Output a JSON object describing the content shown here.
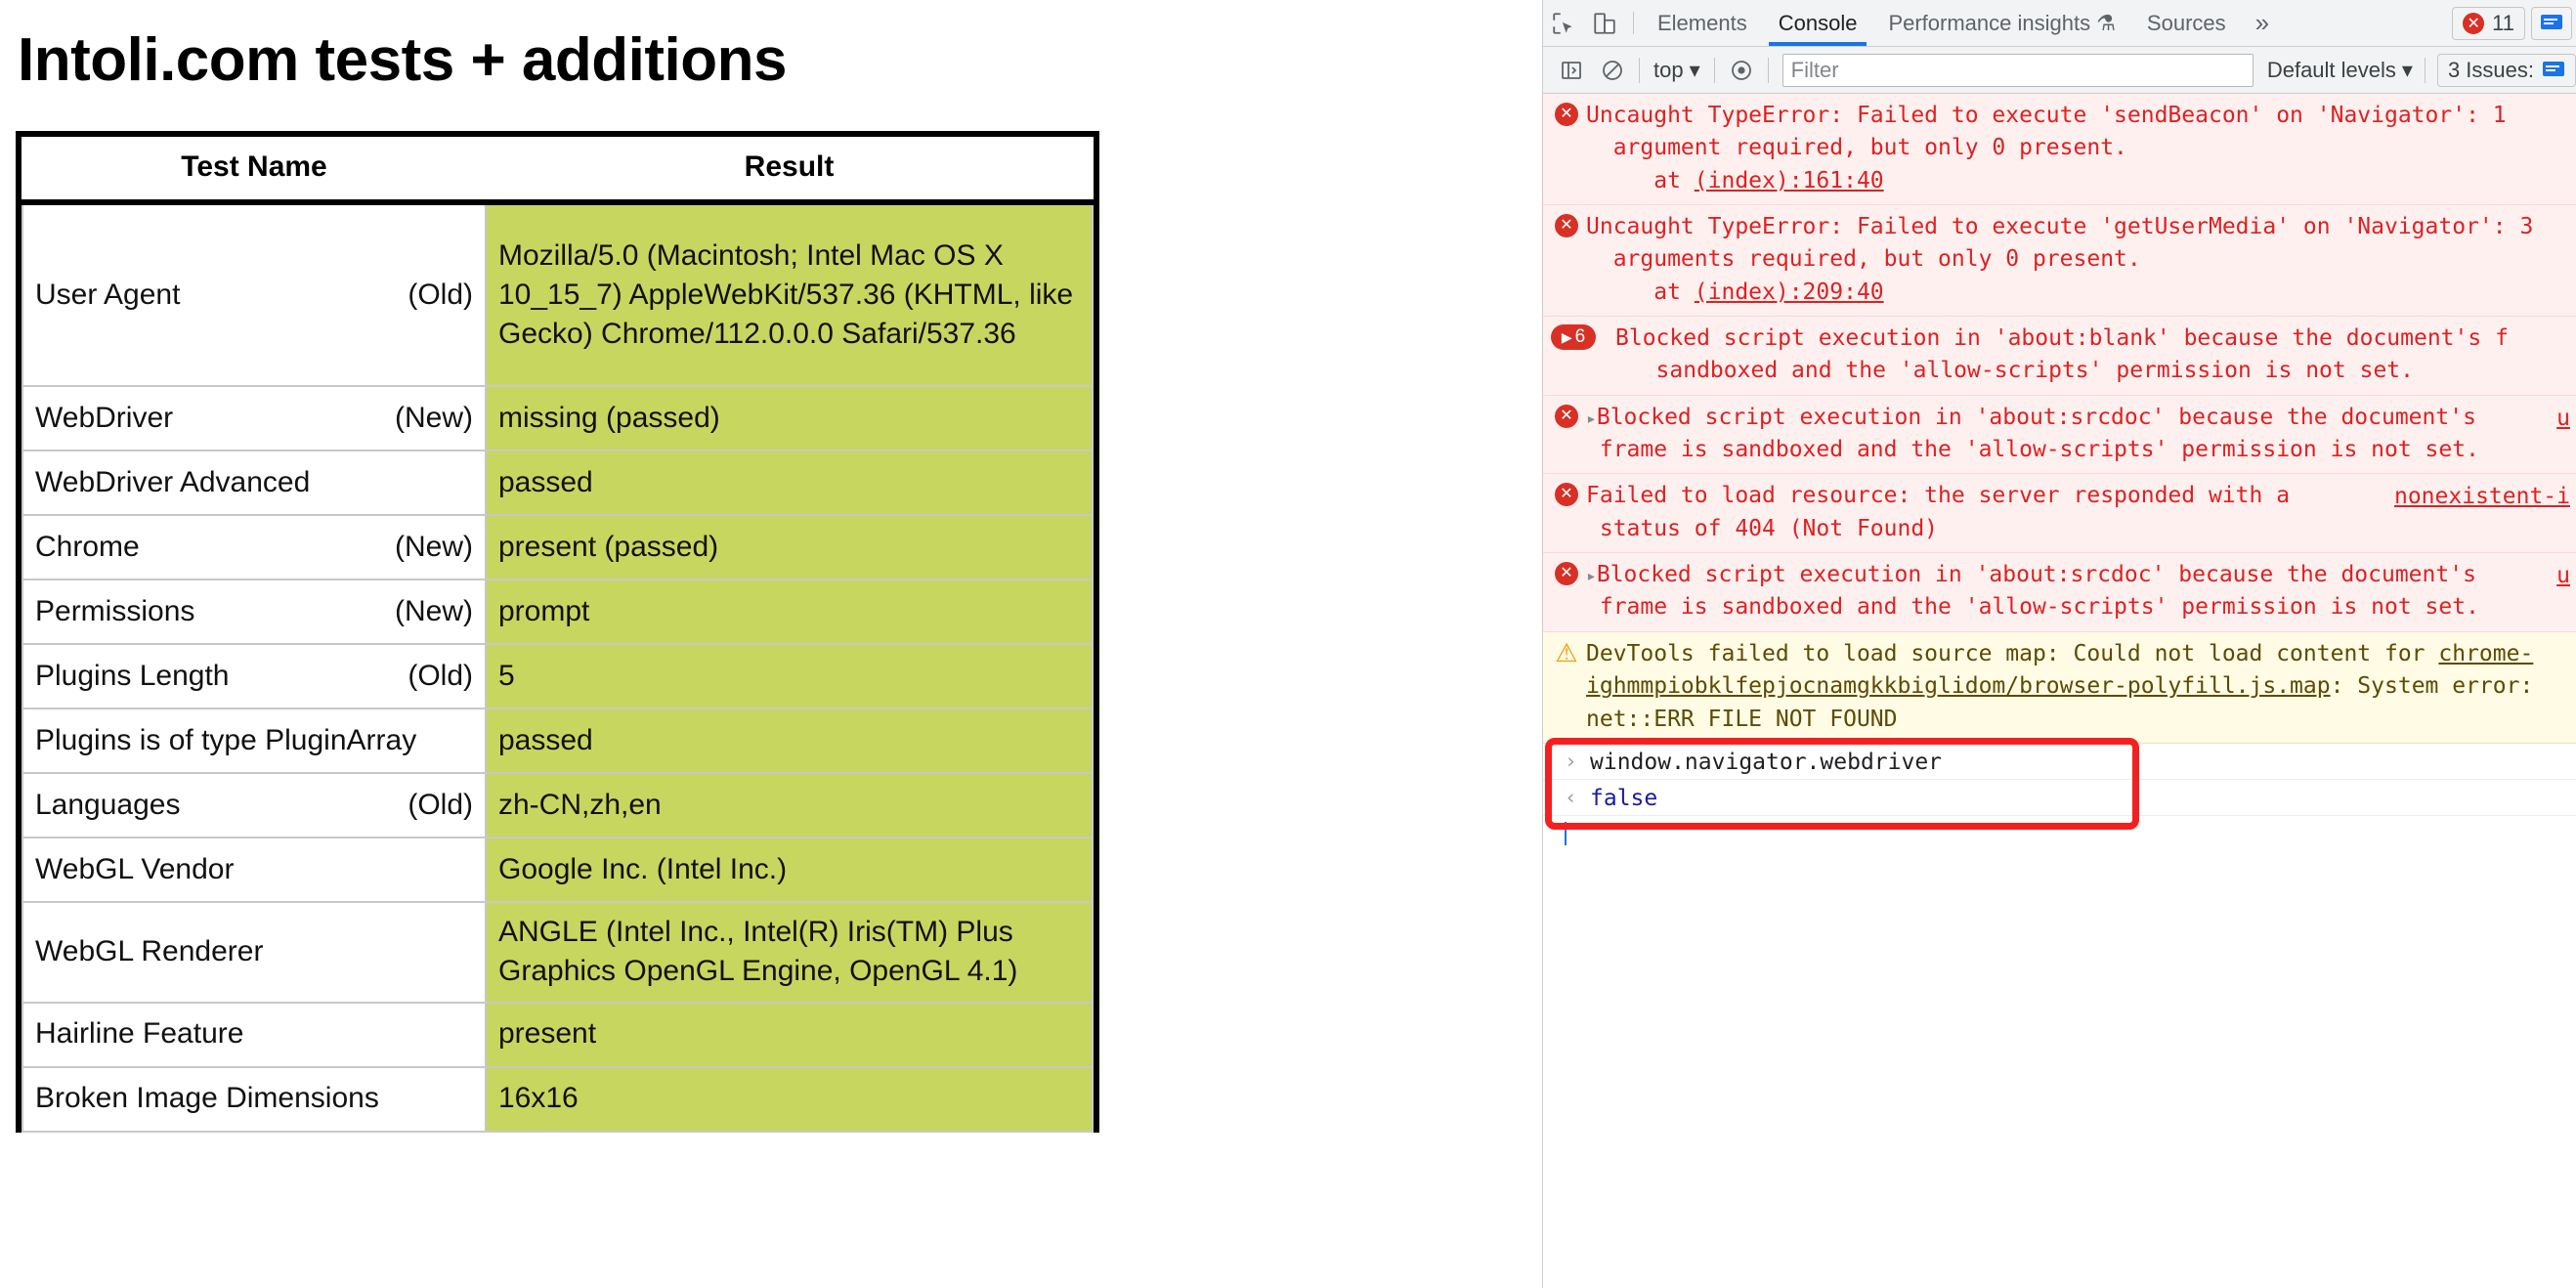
{
  "page": {
    "title": "Intoli.com tests + additions",
    "table": {
      "columns": [
        "Test Name",
        "Result"
      ],
      "rows": [
        {
          "name": "User Agent",
          "age": "(Old)",
          "result": "Mozilla/5.0 (Macintosh; Intel Mac OS X 10_15_7) AppleWebKit/537.36 (KHTML, like Gecko) Chrome/112.0.0.0 Safari/537.36"
        },
        {
          "name": "WebDriver",
          "age": "(New)",
          "result": "missing (passed)"
        },
        {
          "name": "WebDriver Advanced",
          "age": "",
          "result": "passed"
        },
        {
          "name": "Chrome",
          "age": "(New)",
          "result": "present (passed)"
        },
        {
          "name": "Permissions",
          "age": "(New)",
          "result": "prompt"
        },
        {
          "name": "Plugins Length",
          "age": "(Old)",
          "result": "5"
        },
        {
          "name": "Plugins is of type PluginArray",
          "age": "",
          "result": "passed"
        },
        {
          "name": "Languages",
          "age": "(Old)",
          "result": "zh-CN,zh,en"
        },
        {
          "name": "WebGL Vendor",
          "age": "",
          "result": "Google Inc. (Intel Inc.)"
        },
        {
          "name": "WebGL Renderer",
          "age": "",
          "result": "ANGLE (Intel Inc., Intel(R) Iris(TM) Plus Graphics OpenGL Engine, OpenGL 4.1)"
        },
        {
          "name": "Hairline Feature",
          "age": "",
          "result": "present"
        },
        {
          "name": "Broken Image Dimensions",
          "age": "",
          "result": "16x16"
        }
      ]
    },
    "colors": {
      "pass_green": "#c7d65f",
      "border": "#000000"
    }
  },
  "devtools": {
    "tabs": [
      {
        "label": "Elements",
        "active": false
      },
      {
        "label": "Console",
        "active": true
      },
      {
        "label": "Performance insights ⚗",
        "active": false
      },
      {
        "label": "Sources",
        "active": false
      }
    ],
    "more_label": "»",
    "error_count": "11",
    "toolbar": {
      "context": "top",
      "filter_placeholder": "Filter",
      "levels": "Default levels",
      "issues": "3 Issues:"
    },
    "messages": [
      {
        "kind": "error",
        "icon": "error-circle-icon",
        "text": "Uncaught TypeError: Failed to execute 'sendBeacon' on 'Navigator': 1\n  argument required, but only 0 present.\n     at ",
        "link": "(index):161:40",
        "source": ""
      },
      {
        "kind": "error",
        "icon": "error-circle-icon",
        "text": "Uncaught TypeError: Failed to execute 'getUserMedia' on 'Navigator': 3\n  arguments required, but only 0 present.\n     at ",
        "link": "(index):209:40",
        "source": ""
      },
      {
        "kind": "error",
        "icon": "error-count-icon",
        "count": "6",
        "text": "Blocked script execution in 'about:blank' because the document's f\n   sandboxed and the 'allow-scripts' permission is not set.",
        "link": "",
        "source": ""
      },
      {
        "kind": "error",
        "icon": "error-circle-icon",
        "expandable": "▸",
        "text": "Blocked script execution in 'about:srcdoc' because the document's\n frame is sandboxed and the 'allow-scripts' permission is not set.",
        "link": "",
        "source": "u"
      },
      {
        "kind": "error",
        "icon": "error-circle-icon",
        "text": "Failed to load resource: the server responded with a\n status of 404 (Not Found)",
        "link": "",
        "source": "nonexistent-i"
      },
      {
        "kind": "error",
        "icon": "error-circle-icon",
        "expandable": "▸",
        "text": "Blocked script execution in 'about:srcdoc' because the document's\n frame is sandboxed and the 'allow-scripts' permission is not set.",
        "link": "",
        "source": "u"
      },
      {
        "kind": "warn",
        "icon": "warning-triangle-icon",
        "text": "DevTools failed to load source map: Could not load content for ",
        "text2": "ighmmpiobklfepjocnamgkkbiglidom/browser-polyfill.js.map",
        "text3": ": System error:",
        "text4": "net::ERR FILE NOT FOUND",
        "link": "chrome-",
        "source": ""
      }
    ],
    "prompt": {
      "input_chevron": "›",
      "input_text": "window.navigator.webdriver",
      "output_chevron": "‹",
      "output_text": "false",
      "highlight_color": "#f42020"
    }
  }
}
